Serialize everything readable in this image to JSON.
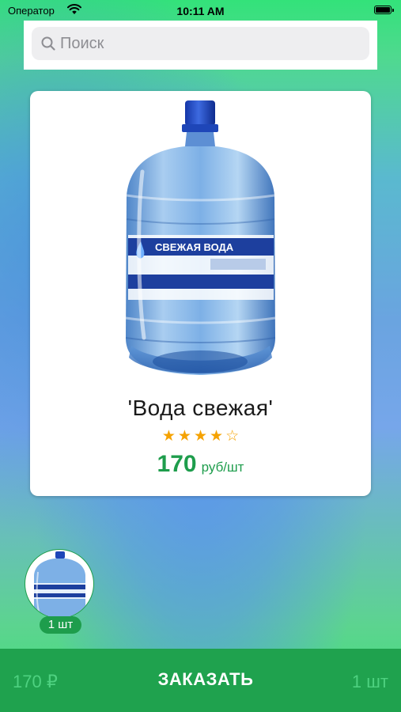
{
  "status_bar": {
    "carrier": "Оператор",
    "time": "10:11 AM"
  },
  "search": {
    "placeholder": "Поиск",
    "icon": "search-icon"
  },
  "product": {
    "title": "'Вода свежая'",
    "label_text": "СВЕЖАЯ ВОДА",
    "rating": 4,
    "rating_max": 5,
    "price": "170",
    "price_unit": "руб/шт"
  },
  "cart": {
    "badge": "1 шт"
  },
  "order_bar": {
    "total": "170 ₽",
    "order_label": "ЗАКАЗАТЬ",
    "count": "1 шт"
  },
  "colors": {
    "accent_green": "#1e9d4c",
    "order_bar_green": "#1fa24e",
    "star_orange": "#f5a200"
  }
}
